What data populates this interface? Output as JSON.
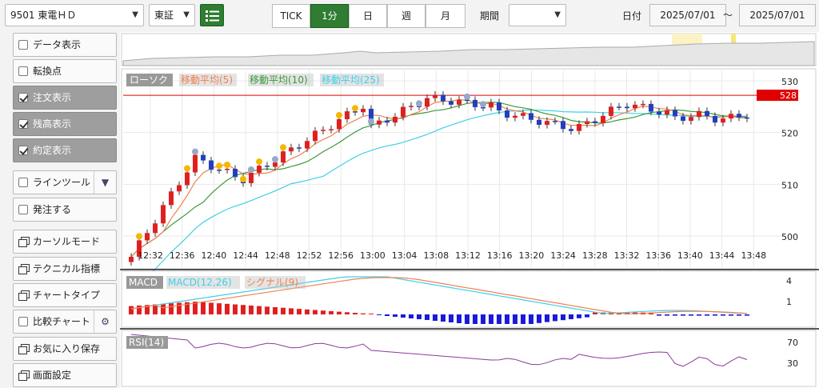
{
  "toolbar": {
    "symbol": "9501 東電ＨＤ",
    "market": "東証",
    "periods": [
      "TICK",
      "1分",
      "日",
      "週",
      "月"
    ],
    "active_period": "1分",
    "range_label": "期間",
    "range_value": "",
    "date_label": "日付",
    "date_from": "2025/07/01",
    "date_sep": "～",
    "date_to": "2025/07/01"
  },
  "sidebar": {
    "items": [
      {
        "label": "データ表示",
        "type": "check",
        "checked": false
      },
      {
        "label": "転換点",
        "type": "check",
        "checked": false
      },
      {
        "label": "注文表示",
        "type": "check",
        "checked": true
      },
      {
        "label": "残高表示",
        "type": "check",
        "checked": true
      },
      {
        "label": "約定表示",
        "type": "check",
        "checked": true
      },
      {
        "label": "ラインツール",
        "type": "check",
        "checked": false
      },
      {
        "label": "発注する",
        "type": "check",
        "checked": false
      },
      {
        "label": "カーソルモード",
        "type": "window"
      },
      {
        "label": "テクニカル指標",
        "type": "window"
      },
      {
        "label": "チャートタイプ",
        "type": "window"
      },
      {
        "label": "比較チャート",
        "type": "check",
        "checked": false
      },
      {
        "label": "お気に入り保存",
        "type": "window"
      },
      {
        "label": "画面設定",
        "type": "window"
      }
    ]
  },
  "chart_data": {
    "type": "candlestick",
    "legend": [
      "ローソク",
      "移動平均(5)",
      "移動平均(10)",
      "移動平均(25)"
    ],
    "colors": {
      "up": "#e02020",
      "down": "#2040c0",
      "ma5": "#f08050",
      "ma10": "#3a9a3a",
      "ma25": "#40d0e8",
      "price_line": "#e00000",
      "macd": "#40d0e8",
      "signal": "#f08050",
      "rsi": "#8a3a9a"
    },
    "y_ticks": [
      530,
      520,
      510,
      500
    ],
    "ylim": [
      494,
      532
    ],
    "current_price": "528",
    "current_price_value": 527.2,
    "x_ticks": [
      "12:32",
      "12:36",
      "12:40",
      "12:44",
      "12:48",
      "12:52",
      "12:56",
      "13:00",
      "13:04",
      "13:08",
      "13:12",
      "13:16",
      "13:20",
      "13:24",
      "13:28",
      "13:32",
      "13:36",
      "13:40",
      "13:44",
      "13:48"
    ],
    "macd_panel": {
      "legend": [
        "MACD",
        "MACD(12,26)",
        "シグナル(9)"
      ],
      "y_ticks": [
        "4",
        "1"
      ]
    },
    "rsi_panel": {
      "legend": [
        "RSI(14)"
      ],
      "y_ticks": [
        "70",
        "30"
      ]
    }
  }
}
